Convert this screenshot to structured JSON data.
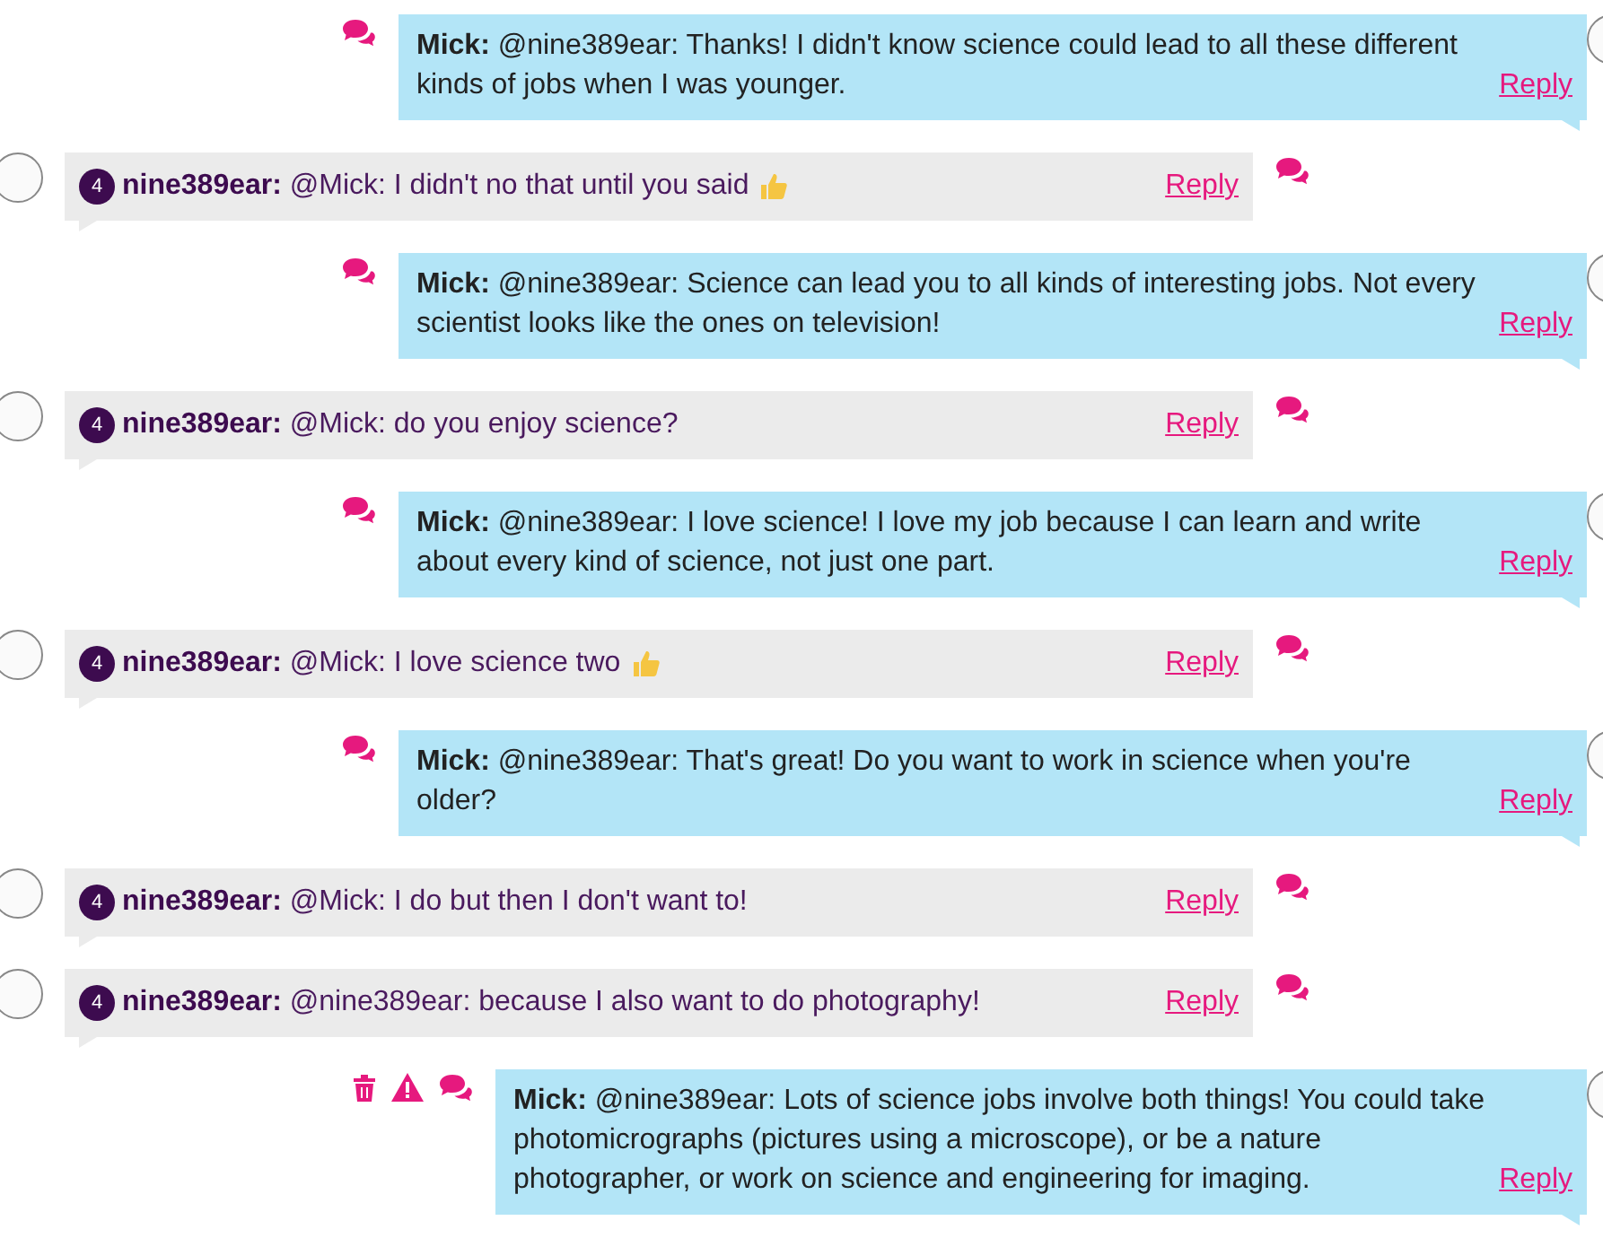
{
  "messages": [
    {
      "kind": "staff",
      "author": "Mick:",
      "text": "@nine389ear: Thanks! I didn't know science could lead to all these different kinds of jobs when I was younger.",
      "reply": "Reply",
      "can_moderate": false
    },
    {
      "kind": "user",
      "badge": "4",
      "author": "nine389ear:",
      "text": "@Mick: I didn't no that until you said",
      "thumbs_up": true,
      "reply": "Reply"
    },
    {
      "kind": "staff",
      "author": "Mick:",
      "text": "@nine389ear: Science can lead you to all kinds of interesting jobs. Not every scientist looks like the ones on television!",
      "reply": "Reply",
      "can_moderate": false
    },
    {
      "kind": "user",
      "badge": "4",
      "author": "nine389ear:",
      "text": "@Mick: do you enjoy science?",
      "thumbs_up": false,
      "reply": "Reply"
    },
    {
      "kind": "staff",
      "author": "Mick:",
      "text": "@nine389ear: I love science! I love my job because I can learn and write about every kind of science, not just one part.",
      "reply": "Reply",
      "can_moderate": false
    },
    {
      "kind": "user",
      "badge": "4",
      "author": "nine389ear:",
      "text": "@Mick: I love science two",
      "thumbs_up": true,
      "reply": "Reply"
    },
    {
      "kind": "staff",
      "author": "Mick:",
      "text": "@nine389ear: That's great! Do you want to work in science when you're older?",
      "reply": "Reply",
      "can_moderate": false
    },
    {
      "kind": "user",
      "badge": "4",
      "author": "nine389ear:",
      "text": "@Mick: I do but then I don't want to!",
      "thumbs_up": false,
      "reply": "Reply"
    },
    {
      "kind": "user",
      "badge": "4",
      "author": "nine389ear:",
      "text": "@nine389ear: because I also want to do photography!",
      "thumbs_up": false,
      "reply": "Reply"
    },
    {
      "kind": "staff",
      "author": "Mick:",
      "text": "@nine389ear: Lots of science jobs involve both things! You could take photomicrographs (pictures using a microscope), or be a nature photographer, or work on science and engineering for imaging.",
      "reply": "Reply",
      "can_moderate": true
    }
  ]
}
